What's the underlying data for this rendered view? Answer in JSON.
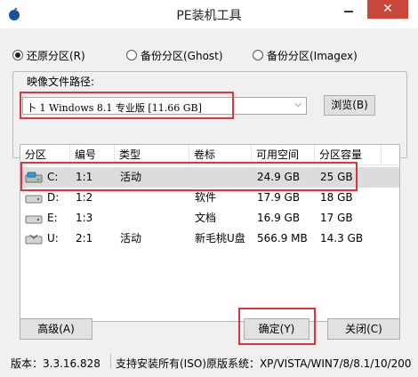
{
  "window": {
    "title": "PE装机工具",
    "close_glyph": "✕"
  },
  "modes": [
    {
      "label": "还原分区(R)",
      "checked": true
    },
    {
      "label": "备份分区(Ghost)",
      "checked": false
    },
    {
      "label": "备份分区(Imagex)",
      "checked": false
    }
  ],
  "image_path": {
    "group_label": "映像文件路径:",
    "selected_value": "卜 1 Windows 8.1 专业版 [11.66 GB]",
    "browse_label": "浏览(B)"
  },
  "partition_table": {
    "columns": [
      "分区",
      "编号",
      "类型",
      "卷标",
      "可用空间",
      "分区容量"
    ],
    "rows": [
      {
        "drive": "C:",
        "number": "1:1",
        "type": "活动",
        "label": "",
        "free": "24.9 GB",
        "size": "25 GB",
        "icon": "system-drive-icon",
        "selected": true
      },
      {
        "drive": "D:",
        "number": "1:2",
        "type": "",
        "label": "软件",
        "free": "17.9 GB",
        "size": "18 GB",
        "icon": "hard-drive-icon",
        "selected": false
      },
      {
        "drive": "E:",
        "number": "1:3",
        "type": "",
        "label": "文档",
        "free": "16.9 GB",
        "size": "17 GB",
        "icon": "hard-drive-icon",
        "selected": false
      },
      {
        "drive": "U:",
        "number": "2:1",
        "type": "活动",
        "label": "新毛桃U盘",
        "free": "566.9 MB",
        "size": "14.3 GB",
        "icon": "usb-drive-icon",
        "selected": false
      }
    ]
  },
  "buttons": {
    "advanced": "高级(A)",
    "ok": "确定(Y)",
    "close": "关闭(C)"
  },
  "status": {
    "version": "版本：3.3.16.828",
    "support": "支持安装所有(ISO)原版系统：XP/VISTA/WIN7/8/8.1/10/200"
  },
  "colors": {
    "highlight": "#d9363e",
    "close_button": "#c7473d",
    "selected_row": "#dcdcdc"
  }
}
